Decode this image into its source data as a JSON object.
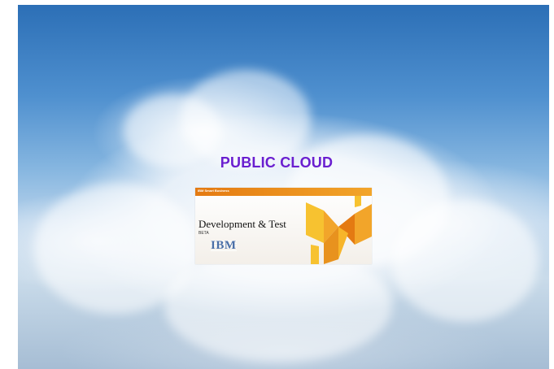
{
  "slide": {
    "title": "PUBLIC CLOUD",
    "title_color": "#6a1fd0"
  },
  "product_card": {
    "header_label": "IBM Smart Business",
    "heading": "Development & Test",
    "badge": "BETA",
    "logo_text": "IBM",
    "accent_colors": [
      "#f2a52a",
      "#e47a12",
      "#f7c230"
    ]
  },
  "background": {
    "icon": "sky-clouds-photo"
  }
}
